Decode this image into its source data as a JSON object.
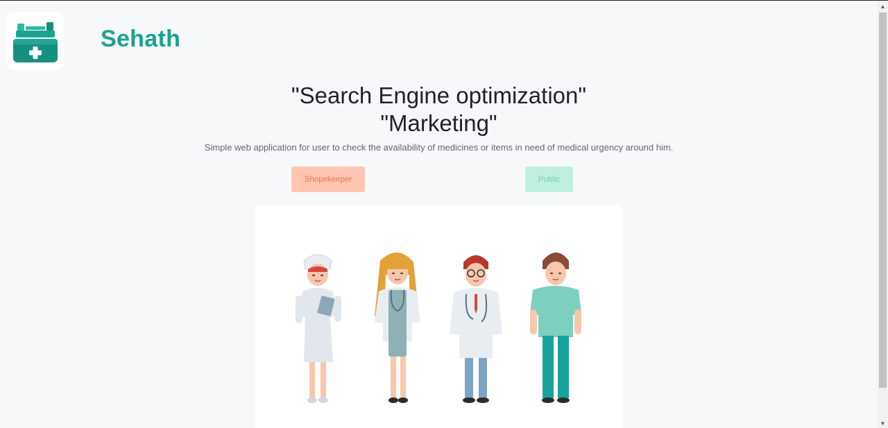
{
  "brand": {
    "name": "Sehath",
    "logo_icon": "medical-kit-icon",
    "color": "#1aa391"
  },
  "hero": {
    "line1": "\"Search Engine optimization\"",
    "line2": "\"Marketing\"",
    "subtitle": "Simple web application for user to check the availability of medicines or items in need of medical urgency around him."
  },
  "buttons": {
    "shopkeeper": "Shopekeeper",
    "public": "Public"
  },
  "illustration": {
    "icon": "medical-staff-illustration"
  },
  "scrollbar": {
    "up_icon": "arrow-up-icon",
    "down_icon": "arrow-down-icon"
  }
}
